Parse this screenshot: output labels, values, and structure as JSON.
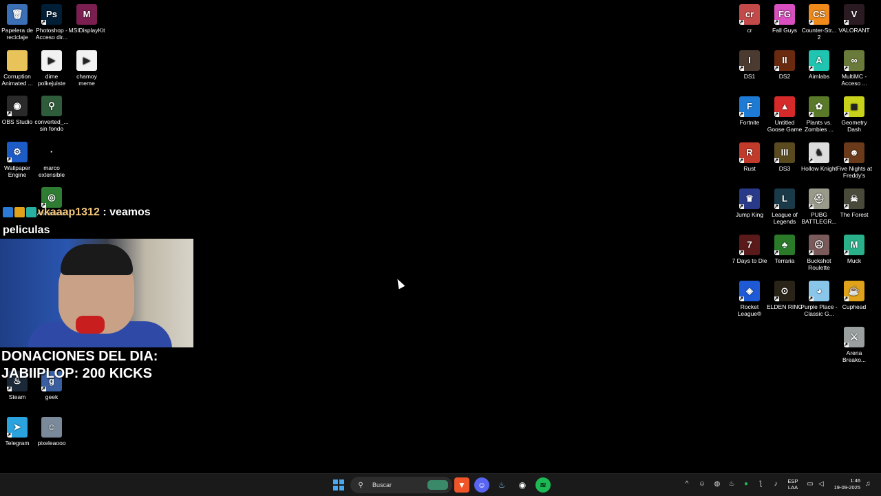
{
  "desktop_left": [
    {
      "label": "Papelera de reciclaje",
      "icon": "recycle-bin-icon",
      "color": "#3b6fb6",
      "glyph": "🗑",
      "shortcut": false
    },
    {
      "label": "Photoshop - Acceso dir...",
      "icon": "photoshop-icon",
      "color": "#001e36",
      "glyph": "Ps",
      "shortcut": true
    },
    {
      "label": "MSIDisplayKit",
      "icon": "msi-displaykit-icon",
      "color": "#7a1f4f",
      "glyph": "M",
      "shortcut": false
    },
    {
      "label": "Corruption Animated ...",
      "icon": "folder-icon",
      "color": "#e8c35a",
      "glyph": "",
      "shortcut": false
    },
    {
      "label": "dime polkejuiste",
      "icon": "video-file-icon",
      "color": "#f2f2f2",
      "glyph": "▶",
      "shortcut": false
    },
    {
      "label": "chamoy meme",
      "icon": "video-file-icon",
      "color": "#f2f2f2",
      "glyph": "▶",
      "shortcut": false
    },
    {
      "label": "OBS Studio",
      "icon": "obs-studio-icon",
      "color": "#2a2a2a",
      "glyph": "◉",
      "shortcut": true
    },
    {
      "label": "converted_... sin fondo",
      "icon": "image-file-icon",
      "color": "#2f5c3a",
      "glyph": "⚲",
      "shortcut": false
    },
    {
      "label": "Wallpaper Engine",
      "icon": "wallpaper-engine-icon",
      "color": "#1d5bc7",
      "glyph": "⚙",
      "shortcut": true
    },
    {
      "label": "marco extensible",
      "icon": "image-file-icon",
      "color": "#000000",
      "glyph": "·",
      "shortcut": false
    },
    {
      "label": "Afterburner",
      "icon": "afterburner-icon",
      "color": "#2e7d32",
      "glyph": "◎",
      "shortcut": true
    },
    {
      "label": "Steam",
      "icon": "steam-icon",
      "color": "#1b2838",
      "glyph": "♨",
      "shortcut": true
    },
    {
      "label": "geek",
      "icon": "geek-icon",
      "color": "#3a5fa0",
      "glyph": "g",
      "shortcut": true
    },
    {
      "label": "Telegram",
      "icon": "telegram-icon",
      "color": "#2aa3df",
      "glyph": "➤",
      "shortcut": true
    },
    {
      "label": "pixeleaooo",
      "icon": "image-file-icon",
      "color": "#7a8a9a",
      "glyph": "☺",
      "shortcut": false
    }
  ],
  "desktop_right": [
    {
      "label": "cr",
      "icon": "cr-game-icon",
      "color": "#c44a4a",
      "glyph": "cr"
    },
    {
      "label": "Fall Guys",
      "icon": "fall-guys-icon",
      "color": "#d94fbf",
      "glyph": "FG"
    },
    {
      "label": "Counter-Str... 2",
      "icon": "counter-strike-icon",
      "color": "#f08a1a",
      "glyph": "CS"
    },
    {
      "label": "VALORANT",
      "icon": "valorant-icon",
      "color": "#2a1a22",
      "glyph": "V"
    },
    {
      "label": "DS1",
      "icon": "dark-souls-icon",
      "color": "#4a3a30",
      "glyph": "I"
    },
    {
      "label": "DS2",
      "icon": "dark-souls-icon",
      "color": "#6a2a10",
      "glyph": "II"
    },
    {
      "label": "Aimlabs",
      "icon": "aimlabs-icon",
      "color": "#1fc5b0",
      "glyph": "A"
    },
    {
      "label": "MultiMC - Acceso ...",
      "icon": "multimc-icon",
      "color": "#6a7a3a",
      "glyph": "∞"
    },
    {
      "label": "Fortnite",
      "icon": "fortnite-icon",
      "color": "#1d7bd6",
      "glyph": "F"
    },
    {
      "label": "Untitled Goose Game",
      "icon": "goose-game-icon",
      "color": "#d62a2a",
      "glyph": "▲"
    },
    {
      "label": "Plants vs. Zombies ...",
      "icon": "pvz-icon",
      "color": "#5a7a2a",
      "glyph": "✿"
    },
    {
      "label": "Geometry Dash",
      "icon": "geometry-dash-icon",
      "color": "#c9d21a",
      "glyph": "◼"
    },
    {
      "label": "Rust",
      "icon": "rust-icon",
      "color": "#c23a2a",
      "glyph": "R"
    },
    {
      "label": "DS3",
      "icon": "dark-souls-icon",
      "color": "#5a4a20",
      "glyph": "III"
    },
    {
      "label": "Hollow Knight",
      "icon": "hollow-knight-icon",
      "color": "#dcdcdc",
      "glyph": "♞"
    },
    {
      "label": "Five Nights at Freddy's",
      "icon": "fnaf-icon",
      "color": "#6a3a1a",
      "glyph": "☻"
    },
    {
      "label": "Jump King",
      "icon": "jump-king-icon",
      "color": "#2a3a8a",
      "glyph": "♛"
    },
    {
      "label": "League of Legends",
      "icon": "league-icon",
      "color": "#1a3a4a",
      "glyph": "L"
    },
    {
      "label": "PUBG BATTLEGR...",
      "icon": "pubg-icon",
      "color": "#9a9a8a",
      "glyph": "⛑"
    },
    {
      "label": "The Forest",
      "icon": "the-forest-icon",
      "color": "#4a4a3a",
      "glyph": "☠"
    },
    {
      "label": "7 Days to Die",
      "icon": "seven-days-icon",
      "color": "#5a1a1a",
      "glyph": "7"
    },
    {
      "label": "Terraria",
      "icon": "terraria-icon",
      "color": "#2a7a2a",
      "glyph": "♣"
    },
    {
      "label": "Buckshot Roulette",
      "icon": "buckshot-icon",
      "color": "#7a5a5a",
      "glyph": "☹"
    },
    {
      "label": "Muck",
      "icon": "muck-icon",
      "color": "#2ab08a",
      "glyph": "M"
    },
    {
      "label": "Rocket League®",
      "icon": "rocket-league-icon",
      "color": "#1e5ad6",
      "glyph": "◈"
    },
    {
      "label": "ELDEN RING",
      "icon": "elden-ring-icon",
      "color": "#2a2418",
      "glyph": "⊙"
    },
    {
      "label": "Purple Place - Classic G...",
      "icon": "purple-place-icon",
      "color": "#8ac6ea",
      "glyph": "◕"
    },
    {
      "label": "Cuphead",
      "icon": "cuphead-icon",
      "color": "#e0a21a",
      "glyph": "☕"
    },
    {
      "label": "Arena Breako...",
      "icon": "arena-breakout-icon",
      "color": "#9aa0a0",
      "glyph": "⚔"
    }
  ],
  "overlay": {
    "chat_user": "vkaaap1312",
    "chat_message": ": veamos peliculas",
    "donations_title": "DONACIONES DEL DIA:",
    "donations_line": "JABIIPLOP: 200 KICKS"
  },
  "taskbar": {
    "search_placeholder": "Buscar",
    "apps": [
      {
        "name": "start-button",
        "icon": "windows-icon",
        "color": "#2f8fe8"
      },
      {
        "name": "taskbar-brave",
        "icon": "brave-icon",
        "color": "#f0552a"
      },
      {
        "name": "taskbar-discord",
        "icon": "discord-icon",
        "color": "#5865f2"
      },
      {
        "name": "taskbar-steam",
        "icon": "steam-icon",
        "color": "#1b2838"
      },
      {
        "name": "taskbar-obs",
        "icon": "obs-icon",
        "color": "#3a3a3a"
      },
      {
        "name": "taskbar-spotify",
        "icon": "spotify-icon",
        "color": "#1db954"
      }
    ],
    "lang_1": "ESP",
    "lang_2": "LAA",
    "time": "1:46",
    "date": "19-09-2025"
  }
}
